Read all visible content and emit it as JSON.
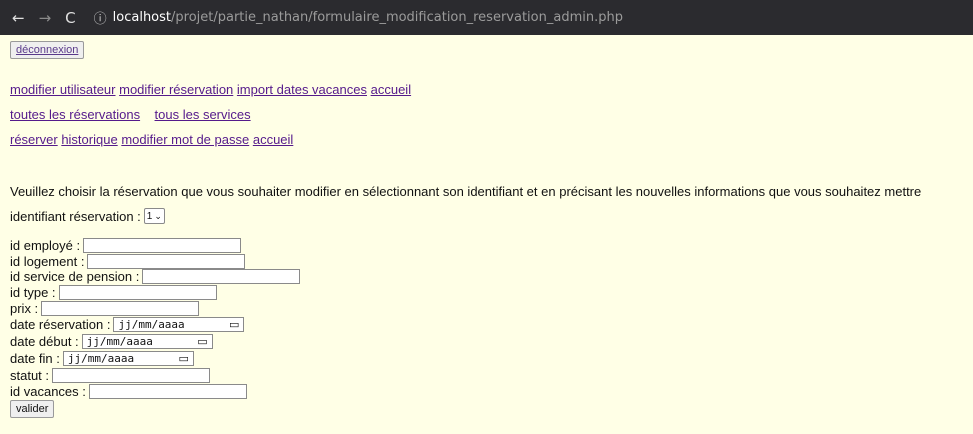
{
  "browser": {
    "back_icon": "←",
    "forward_icon": "→",
    "reload_icon": "C",
    "info_icon": "ⓘ",
    "url_host": "localhost",
    "url_path": "/projet/partie_nathan/formulaire_modification_reservation_admin.php"
  },
  "header": {
    "logout_label": "déconnexion"
  },
  "nav_admin": {
    "items": [
      "modifier utilisateur",
      "modifier réservation",
      "import dates vacances",
      "accueil"
    ]
  },
  "nav_lists": {
    "items": [
      "toutes les réservations",
      "tous les services"
    ]
  },
  "nav_user": {
    "items": [
      "réserver",
      "historique",
      "modifier mot de passe",
      "accueil"
    ]
  },
  "intro": "Veuillez choisir la réservation que vous souhaiter modifier en sélectionnant son identifiant et en précisant les nouvelles informations que vous souhaitez mettre",
  "selector": {
    "label": "identifiant réservation :",
    "value": "1"
  },
  "form": {
    "employe": "id employé :",
    "logement": "id logement :",
    "service": "id service de pension :",
    "type": "id type :",
    "prix": "prix :",
    "date_reservation": "date réservation :",
    "date_debut": "date début :",
    "date_fin": "date fin :",
    "statut": "statut :",
    "vacances": "id vacances :",
    "date_placeholder": "jj/mm/aaaa",
    "submit_label": "valider"
  }
}
